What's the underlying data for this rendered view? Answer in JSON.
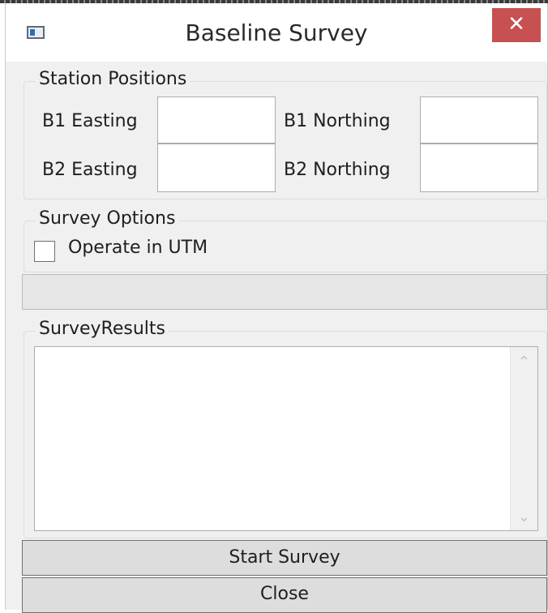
{
  "window": {
    "title": "Baseline Survey",
    "close_glyph": "✕"
  },
  "station_positions": {
    "legend": "Station Positions",
    "b1_easting": {
      "label": "B1 Easting",
      "value": ""
    },
    "b1_northing": {
      "label": "B1 Northing",
      "value": ""
    },
    "b2_easting": {
      "label": "B2 Easting",
      "value": ""
    },
    "b2_northing": {
      "label": "B2 Northing",
      "value": ""
    }
  },
  "survey_options": {
    "legend": "Survey Options",
    "operate_utm": {
      "label": "Operate in UTM",
      "checked": false
    }
  },
  "progress": {
    "value": 0
  },
  "survey_results": {
    "legend": "SurveyResults",
    "text": ""
  },
  "buttons": {
    "start": "Start Survey",
    "close": "Close"
  },
  "icons": {
    "app": "window-app-icon",
    "close": "close-icon",
    "scroll_up": "chevron-up-icon",
    "scroll_down": "chevron-down-icon"
  }
}
